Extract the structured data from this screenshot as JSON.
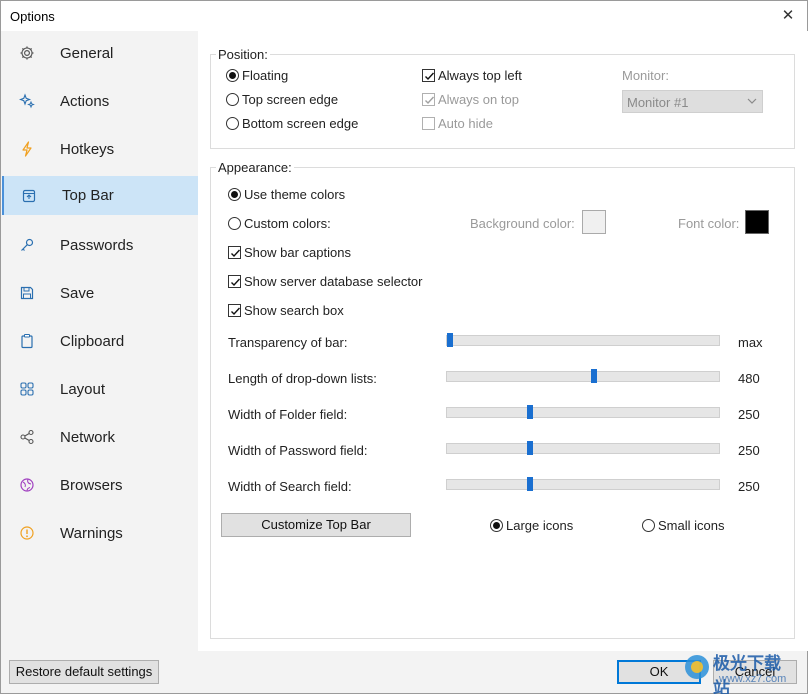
{
  "window": {
    "title": "Options"
  },
  "sidebar": {
    "items": [
      {
        "label": "General",
        "icon": "gear-icon"
      },
      {
        "label": "Actions",
        "icon": "sparkle-icon"
      },
      {
        "label": "Hotkeys",
        "icon": "lightning-icon"
      },
      {
        "label": "Top Bar",
        "icon": "top-bar-icon",
        "active": true
      },
      {
        "label": "Passwords",
        "icon": "key-icon"
      },
      {
        "label": "Save",
        "icon": "floppy-icon"
      },
      {
        "label": "Clipboard",
        "icon": "clipboard-icon"
      },
      {
        "label": "Layout",
        "icon": "grid-icon"
      },
      {
        "label": "Network",
        "icon": "share-icon"
      },
      {
        "label": "Browsers",
        "icon": "globe-icon"
      },
      {
        "label": "Warnings",
        "icon": "warning-icon"
      }
    ]
  },
  "position": {
    "title": "Position:",
    "floating": "Floating",
    "top_edge": "Top screen edge",
    "bottom_edge": "Bottom screen edge",
    "always_top_left": "Always top left",
    "always_on_top": "Always on top",
    "auto_hide": "Auto hide",
    "monitor_label": "Monitor:",
    "monitor_value": "Monitor #1"
  },
  "appearance": {
    "title": "Appearance:",
    "use_theme": "Use theme colors",
    "custom_colors": "Custom colors:",
    "bg_color_label": "Background color:",
    "font_color_label": "Font color:",
    "bg_color": "#f0f0f0",
    "font_color": "#000000",
    "show_captions": "Show bar captions",
    "show_db_selector": "Show server database selector",
    "show_search": "Show search box",
    "sliders": [
      {
        "label": "Transparency of bar:",
        "value_text": "max",
        "fraction": 0.0
      },
      {
        "label": "Length of drop-down lists:",
        "value_text": "480",
        "fraction": 0.54
      },
      {
        "label": "Width of Folder field:",
        "value_text": "250",
        "fraction": 0.3
      },
      {
        "label": "Width of Password field:",
        "value_text": "250",
        "fraction": 0.3
      },
      {
        "label": "Width of Search field:",
        "value_text": "250",
        "fraction": 0.3
      }
    ],
    "customize_button": "Customize Top Bar",
    "large_icons": "Large icons",
    "small_icons": "Small icons"
  },
  "footer": {
    "restore": "Restore default settings",
    "ok": "OK",
    "cancel": "Cancel",
    "watermark": "极光下载站",
    "watermark_sub": "www.xz7.com"
  },
  "colors": {
    "accent": "#0078d7",
    "sidebar_active": "#cce4f7",
    "slider_thumb": "#1a6fd0"
  }
}
